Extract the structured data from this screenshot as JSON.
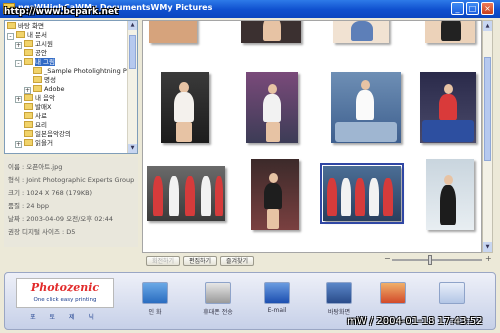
{
  "titlebar": {
    "title": "ngsWHighCaWMy DocumentsWMy Pictures",
    "controls": [
      "_",
      "□",
      "×"
    ]
  },
  "watermark": "http://www.bcpark.net",
  "tree": {
    "items": [
      {
        "label": "바탕 화면",
        "expander": ""
      },
      {
        "label": "내 문서",
        "expander": "-"
      },
      {
        "label": "고시원",
        "expander": "+"
      },
      {
        "label": "공안",
        "expander": ""
      },
      {
        "label": "내 그림",
        "expander": "-",
        "selected": true
      },
      {
        "label": "_Sample Photolightning Pho",
        "expander": ""
      },
      {
        "label": "명성",
        "expander": ""
      },
      {
        "label": "Adobe",
        "expander": "+"
      },
      {
        "label": "내 음악",
        "expander": "+"
      },
      {
        "label": "발매X",
        "expander": ""
      },
      {
        "label": "사료",
        "expander": ""
      },
      {
        "label": "요리",
        "expander": ""
      },
      {
        "label": "일본음악강의",
        "expander": ""
      },
      {
        "label": "읽을거",
        "expander": "+"
      }
    ]
  },
  "info": {
    "rows": [
      "이름 : 오픈아트.jpg",
      "형식 : Joint Photographic Experts Group",
      "크기 : 1024 X 768 (179KB)",
      "품질 : 24 bpp",
      "날짜 : 2003-04-09 오전/오후 02:44",
      "권장 디지털 사이즈 : D5"
    ]
  },
  "actions": {
    "buttons": [
      {
        "label": "회전하기",
        "disabled": true
      },
      {
        "label": "편집하기",
        "disabled": false
      },
      {
        "label": "즐겨찾기",
        "disabled": false
      }
    ],
    "zoom_minus": "−",
    "zoom_plus": "+"
  },
  "bottom": {
    "logo_name": "Photozenic",
    "logo_tagline": "One click easy printing",
    "logo_sub": "포 토 제 닉",
    "tools": [
      {
        "label": "인 화",
        "icon": "print-photo-icon"
      },
      {
        "label": "휴대폰 전송",
        "icon": "mobile-phone-icon"
      },
      {
        "label": "E-mail",
        "icon": "email-icon"
      },
      {
        "label": "바탕화면",
        "icon": "monitor-icon"
      },
      {
        "label": "",
        "icon": "photos-icon"
      },
      {
        "label": "",
        "icon": "help-icon"
      }
    ],
    "timestamp": "mW / 2004-01-18 17:43:52"
  },
  "colors": {
    "titlebar": "#0f4fce",
    "selection": "#316ac5",
    "brand_red": "#e22b2b"
  }
}
